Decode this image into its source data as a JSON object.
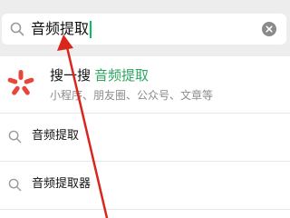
{
  "search": {
    "query": "音频提取",
    "icon": "search-icon",
    "clear_icon": "clear-icon"
  },
  "sousou": {
    "logo_icon": "sousou-logo-icon",
    "name": "搜一搜",
    "keyword": "音频提取",
    "subtitle": "小程序、朋友圈、公众号、文章等"
  },
  "suggestions": [
    {
      "label": "音频提取",
      "icon": "search-icon"
    },
    {
      "label": "音频提取器",
      "icon": "search-icon"
    }
  ],
  "colors": {
    "accent_green": "#2ca560",
    "logo_red": "#e8463a",
    "annotation_red": "#d9261c"
  }
}
